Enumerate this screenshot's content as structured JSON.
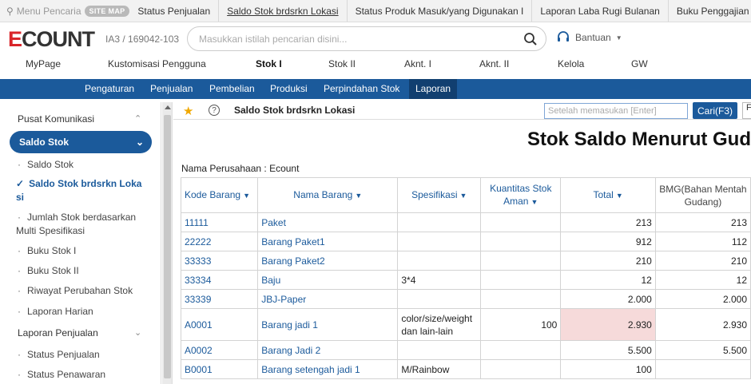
{
  "topbar": {
    "menu_search_placeholder": "Menu Pencaria",
    "sitemap_label": "SITE MAP",
    "links": [
      "Status Penjualan",
      "Saldo Stok brdsrkn Lokasi",
      "Status Produk Masuk/yang Digunakan I",
      "Laporan Laba Rugi Bulanan",
      "Buku Penggajian"
    ]
  },
  "header": {
    "logo_e": "E",
    "logo_rest": "COUNT",
    "account": "IA3 / 169042-103",
    "search_placeholder": "Masukkan istilah pencarian disini...",
    "help_label": "Bantuan"
  },
  "mainnav": [
    "MyPage",
    "Kustomisasi Pengguna",
    "Stok I",
    "Stok II",
    "Aknt. I",
    "Aknt. II",
    "Kelola",
    "GW"
  ],
  "subnav": [
    "Pengaturan",
    "Penjualan",
    "Pembelian",
    "Produksi",
    "Perpindahan Stok",
    "Laporan"
  ],
  "sidebar": {
    "section1": "Pusat Komunikasi",
    "active_group": "Saldo Stok",
    "items": [
      "Saldo Stok",
      "Saldo Stok brdsrkn Loka",
      "si",
      "Jumlah Stok berdasarkan",
      "Multi Spesifikasi",
      "Buku Stok I",
      "Buku Stok II",
      "Riwayat Perubahan Stok",
      "Laporan Harian"
    ],
    "section2": "Laporan Penjualan",
    "items2": [
      "Status Penjualan",
      "Status Penawaran"
    ]
  },
  "content": {
    "page_title": "Saldo Stok brdsrkn Lokasi",
    "search_placeholder": "Setelah memasukan [Enter]",
    "find_button": "Cari(F3)",
    "more_button": "F",
    "report_title": "Stok Saldo Menurut Gud",
    "company_label": "Nama Perusahaan : Ecount",
    "columns": [
      "Kode Barang",
      "Nama Barang",
      "Spesifikasi",
      "Kuantitas Stok Aman",
      "Total",
      "BMG(Bahan Mentah Gudang)"
    ],
    "rows": [
      {
        "code": "11111",
        "name": "Paket",
        "spec": "",
        "safe": "",
        "total": "213",
        "bmg": "213"
      },
      {
        "code": "22222",
        "name": "Barang Paket1",
        "spec": "",
        "safe": "",
        "total": "912",
        "bmg": "112"
      },
      {
        "code": "33333",
        "name": "Barang Paket2",
        "spec": "",
        "safe": "",
        "total": "210",
        "bmg": "210"
      },
      {
        "code": "33334",
        "name": "Baju",
        "spec": "3*4",
        "safe": "",
        "total": "12",
        "bmg": "12"
      },
      {
        "code": "33339",
        "name": "JBJ-Paper",
        "spec": "",
        "safe": "",
        "total": "2.000",
        "bmg": "2.000"
      },
      {
        "code": "A0001",
        "name": "Barang jadi 1",
        "spec": "color/size/weight dan lain-lain",
        "safe": "100",
        "total": "2.930",
        "bmg": "2.930"
      },
      {
        "code": "A0002",
        "name": "Barang Jadi 2",
        "spec": "",
        "safe": "",
        "total": "5.500",
        "bmg": "5.500"
      },
      {
        "code": "B0001",
        "name": "Barang setengah jadi 1",
        "spec": "M/Rainbow",
        "safe": "",
        "total": "100",
        "bmg": ""
      }
    ]
  }
}
